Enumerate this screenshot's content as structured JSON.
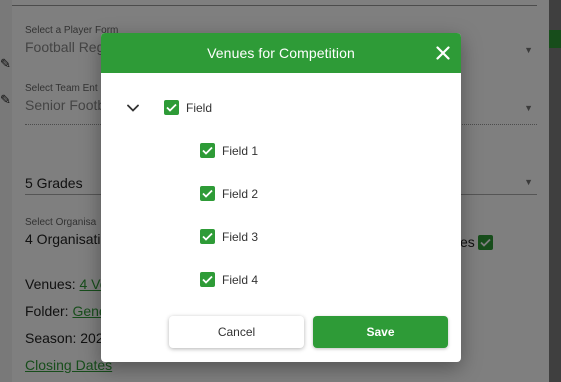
{
  "background": {
    "player_form": {
      "label": "Select a Player Form",
      "value": "Football Reg"
    },
    "team_entry": {
      "label": "Select Team Ent",
      "value": "Senior Footb"
    },
    "grades": {
      "value": "5 Grades"
    },
    "organisation": {
      "label": "Select Organisa",
      "value": "4 Organisati"
    },
    "trailing_text": "es",
    "venues": {
      "label": "Venues:",
      "link": "4 Ve"
    },
    "folder": {
      "label": "Folder:",
      "link": "Gene"
    },
    "season": {
      "label": "Season:",
      "value": "202"
    },
    "closing_dates": "Closing Dates"
  },
  "modal": {
    "title": "Venues for Competition",
    "close_icon": "close-icon",
    "tree": {
      "parent": {
        "label": "Field",
        "checked": true
      },
      "children": [
        {
          "label": "Field 1",
          "checked": true
        },
        {
          "label": "Field 2",
          "checked": true
        },
        {
          "label": "Field 3",
          "checked": true
        },
        {
          "label": "Field 4",
          "checked": true
        }
      ]
    },
    "cancel_label": "Cancel",
    "save_label": "Save"
  },
  "colors": {
    "accent": "#2e9b37",
    "overlay": "rgba(0,0,0,0.5)"
  }
}
